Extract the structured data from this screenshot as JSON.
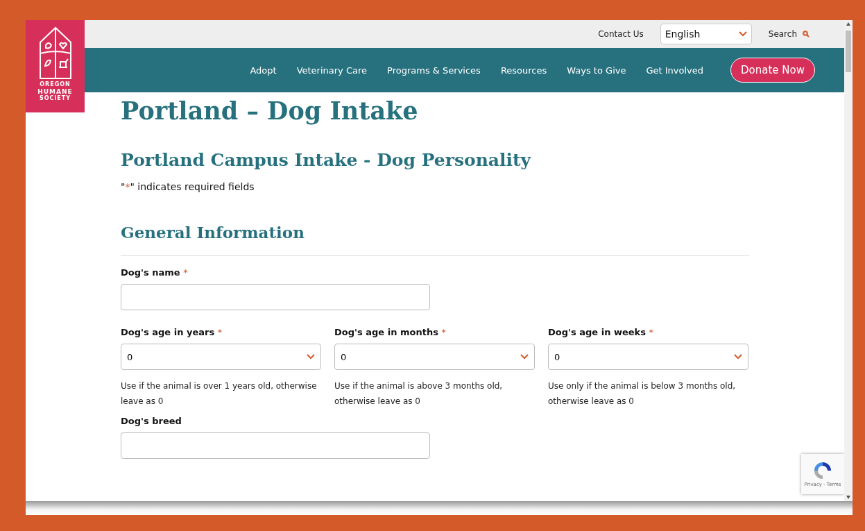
{
  "header": {
    "logo": {
      "lines": [
        "OREGON",
        "HUMANE",
        "SOCIETY"
      ]
    },
    "utility": {
      "contact": "Contact Us",
      "language": {
        "value": "English"
      },
      "search": "Search"
    },
    "nav": [
      "Adopt",
      "Veterinary Care",
      "Programs & Services",
      "Resources",
      "Ways to Give",
      "Get Involved"
    ],
    "donate": "Donate Now"
  },
  "page": {
    "title": "Portland – Dog Intake",
    "form_title": "Portland Campus Intake - Dog Personality",
    "required_note": {
      "open": "\"",
      "mark": "*",
      "close": "\" indicates required fields"
    },
    "section": "General Information",
    "fields": [
      {
        "kind": "text",
        "label": "Dog's name",
        "required_mark": "*"
      },
      {
        "kind": "row",
        "items": [
          {
            "label": "Dog's age in years",
            "required_mark": "*",
            "value": "0",
            "help": "Use if the animal is over 1 years old, otherwise leave as 0"
          },
          {
            "label": "Dog's age in months",
            "required_mark": "*",
            "value": "0",
            "help": "Use if the animal is above 3 months old, otherwise leave as 0"
          },
          {
            "label": "Dog's age in weeks",
            "required_mark": "*",
            "value": "0",
            "help": "Use only if the animal is below 3 months old, otherwise leave as 0"
          }
        ]
      },
      {
        "kind": "text",
        "label": "Dog's breed"
      }
    ]
  },
  "recaptcha": {
    "links": "Privacy - Terms"
  }
}
